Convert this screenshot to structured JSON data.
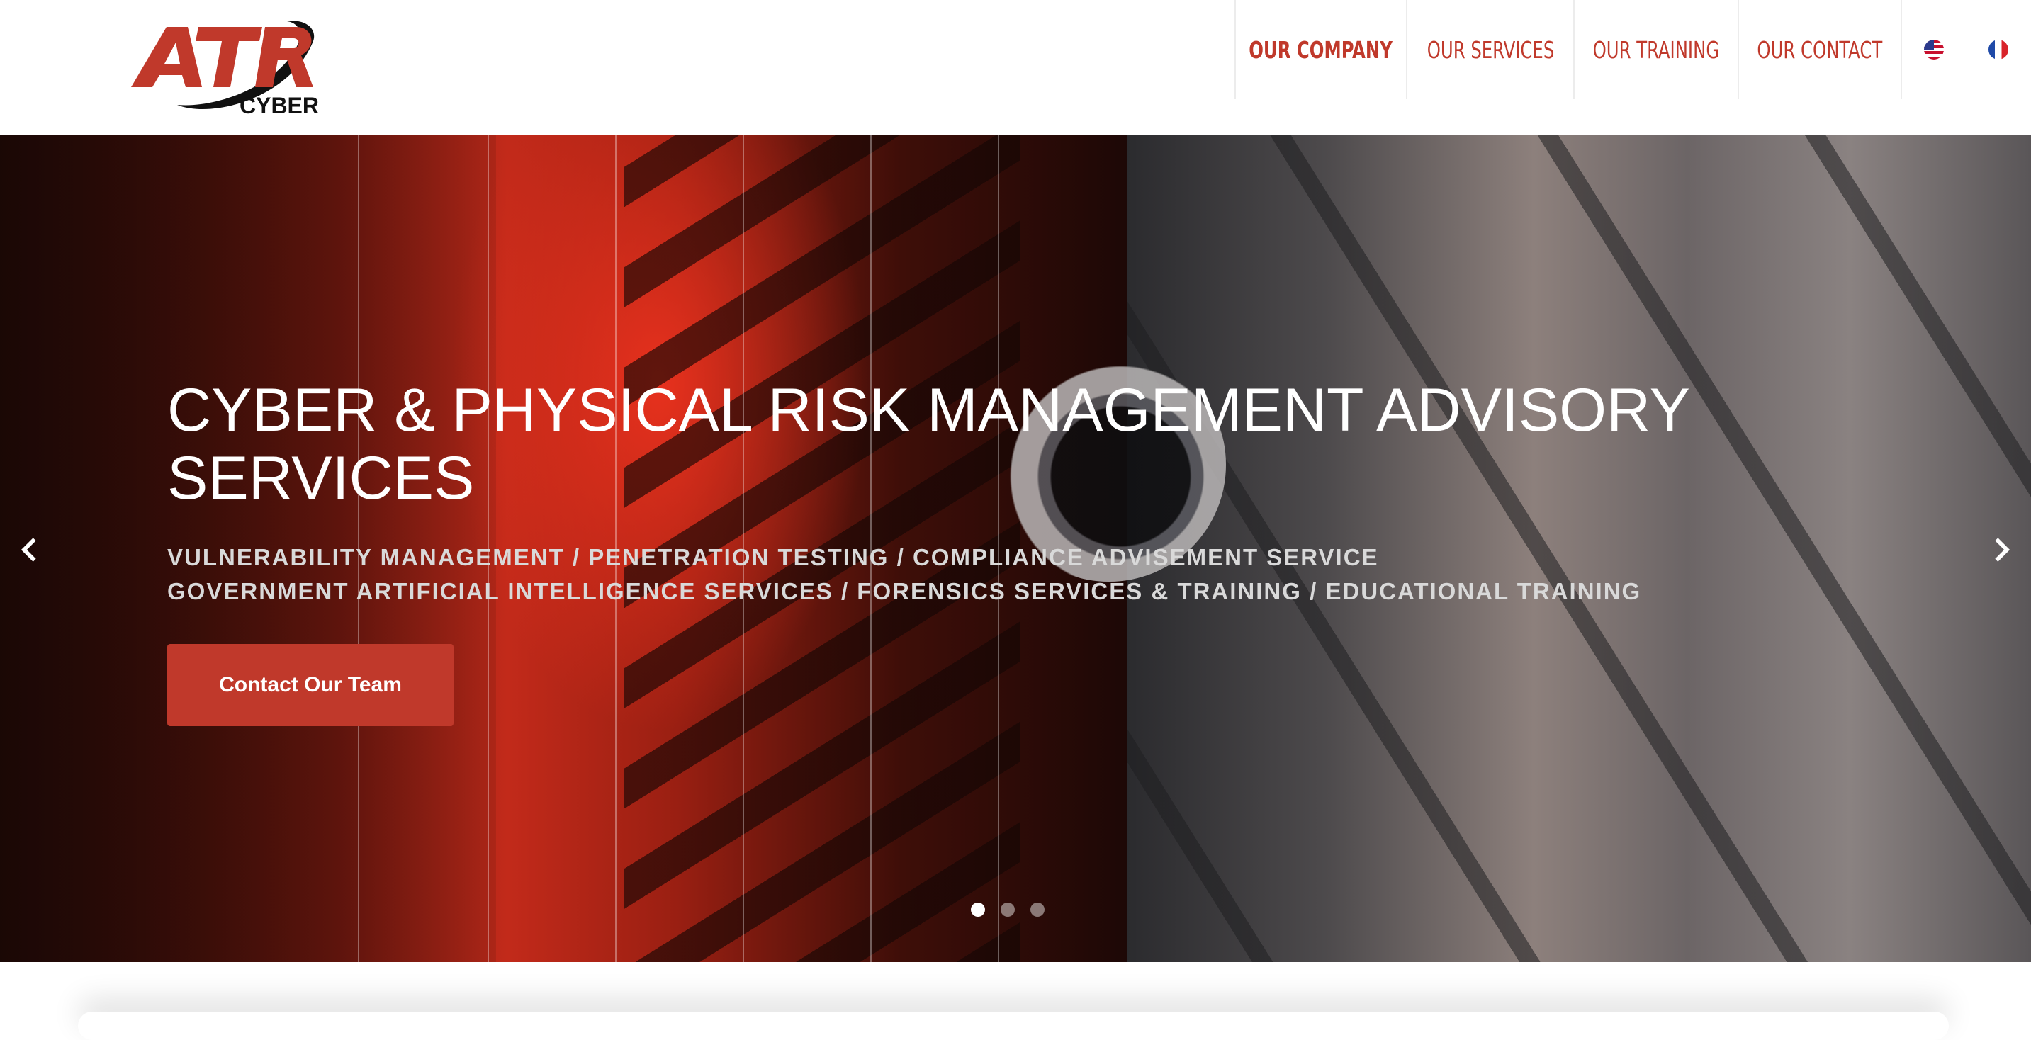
{
  "header": {
    "logo": {
      "mark_text": "ATR",
      "sub_text": "CYBER",
      "icon": "atr-cyber-logo"
    },
    "nav": [
      {
        "label": "OUR COMPANY",
        "active": true
      },
      {
        "label": "OUR SERVICES",
        "active": false
      },
      {
        "label": "OUR TRAINING",
        "active": false
      },
      {
        "label": "OUR CONTACT",
        "active": false
      }
    ],
    "languages": [
      {
        "icon": "us-flag-icon"
      },
      {
        "icon": "fr-flag-icon"
      }
    ]
  },
  "hero": {
    "title": "CYBER & PHYSICAL RISK MANAGEMENT ADVISORY SERVICES",
    "subtitle_lines": [
      "VULNERABILITY MANAGEMENT / PENETRATION TESTING / COMPLIANCE ADVISEMENT SERVICE",
      "GOVERNMENT ARTIFICIAL INTELLIGENCE SERVICES / FORENSICS SERVICES & TRAINING / EDUCATIONAL TRAINING"
    ],
    "cta_label": "Contact Our Team",
    "prev_icon": "chevron-left-icon",
    "next_icon": "chevron-right-icon",
    "slides": {
      "count": 3,
      "active_index": 0
    }
  },
  "colors": {
    "accent": "#c0392b",
    "nav_text": "#c0392b",
    "hero_title": "#ffffff",
    "hero_subtitle": "#d9d9d9"
  }
}
